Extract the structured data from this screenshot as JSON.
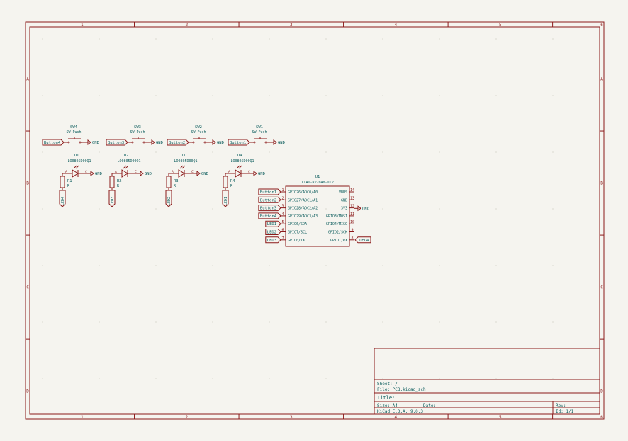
{
  "colors": {
    "background": "#f5f4ef",
    "frame": "#8b1a1a",
    "wire": "#8b1a1a",
    "text": "#0b5c5c",
    "pin_number": "#8b1a1a",
    "label_text": "#0b5c5c",
    "grid": "#c9c6bd"
  },
  "frame": {
    "columns": [
      "1",
      "2",
      "3",
      "4",
      "5",
      "6"
    ],
    "rows": [
      "A",
      "B",
      "C",
      "D"
    ]
  },
  "switches": [
    {
      "ref": "SW4",
      "value": "SW_Push",
      "label": "Button4",
      "gnd": "GND"
    },
    {
      "ref": "SW3",
      "value": "SW_Push",
      "label": "Button3",
      "gnd": "GND"
    },
    {
      "ref": "SW2",
      "value": "SW_Push",
      "label": "Button2",
      "gnd": "GND"
    },
    {
      "ref": "SW1",
      "value": "SW_Push",
      "label": "Button1",
      "gnd": "GND"
    }
  ],
  "leds": [
    {
      "ref": "D1",
      "value": "LO0805D00Q1",
      "res": "R1",
      "res_value": "R",
      "label": "LED4",
      "gnd": "GND",
      "anode": "A",
      "cathode": "C"
    },
    {
      "ref": "D2",
      "value": "LO0805D00Q1",
      "res": "R2",
      "res_value": "R",
      "label": "LED3",
      "gnd": "GND",
      "anode": "A",
      "cathode": "C"
    },
    {
      "ref": "D3",
      "value": "LO0805D00Q1",
      "res": "R3",
      "res_value": "R",
      "label": "LED2",
      "gnd": "GND",
      "anode": "A",
      "cathode": "C"
    },
    {
      "ref": "D4",
      "value": "LO0805D00Q1",
      "res": "R4",
      "res_value": "R",
      "label": "LED1",
      "gnd": "GND",
      "anode": "A",
      "cathode": "C"
    }
  ],
  "mcu": {
    "ref": "U1",
    "value": "XIAO-RP2040-DIP",
    "left_pins": [
      {
        "num": "1",
        "name": "GPIO26/ADC0/A0",
        "net": "Button1"
      },
      {
        "num": "2",
        "name": "GPIO27/ADC1/A1",
        "net": "Button2"
      },
      {
        "num": "3",
        "name": "GPIO28/ADC2/A2",
        "net": "Button3"
      },
      {
        "num": "4",
        "name": "GPIO29/ADC3/A3",
        "net": "Button4"
      },
      {
        "num": "5",
        "name": "GPIO6/SDA",
        "net": "LED1"
      },
      {
        "num": "6",
        "name": "GPIO7/SCL",
        "net": "LED2"
      },
      {
        "num": "7",
        "name": "GPIO0/TX",
        "net": "LED3"
      }
    ],
    "right_pins": [
      {
        "num": "14",
        "name": "VBUS",
        "net": ""
      },
      {
        "num": "13",
        "name": "GND",
        "net": "GND"
      },
      {
        "num": "12",
        "name": "3V3",
        "net": ""
      },
      {
        "num": "11",
        "name": "GPIO3/MOSI",
        "net": ""
      },
      {
        "num": "10",
        "name": "GPIO4/MISO",
        "net": ""
      },
      {
        "num": "9",
        "name": "GPIO2/SCK",
        "net": ""
      },
      {
        "num": "8",
        "name": "GPIO1/RX",
        "net": "LED4"
      }
    ]
  },
  "title_block": {
    "sheet": "Sheet: /",
    "file": "File: PCB.kicad_sch",
    "title": "Title:",
    "size": "Size: A4",
    "date": "Date:",
    "rev": "Rev:",
    "tool": "KiCad E.D.A. 9.0.3",
    "id": "Id: 1/1"
  }
}
